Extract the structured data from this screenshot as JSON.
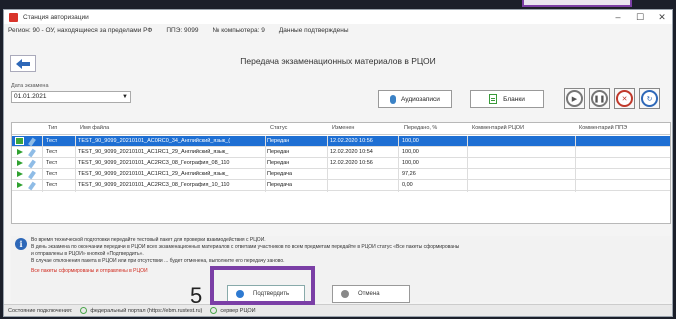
{
  "window": {
    "title": "Станция авторизации"
  },
  "info": {
    "region": "Регион: 90 - ОУ, находящиеся за пределами РФ",
    "ppe": "ППЭ: 9099",
    "computer": "№ компьютера: 9",
    "status": "Данные подтверждены"
  },
  "page": {
    "heading": "Передача экзаменационных материалов в РЦОИ"
  },
  "date": {
    "label": "Дата экзамена",
    "value": "01.01.2021"
  },
  "toolbar": {
    "audio_label": "Аудиозаписи",
    "blanks_label": "Бланки"
  },
  "table": {
    "headers": [
      "Тип",
      "Имя файла",
      "Статус",
      "Изменен",
      "Передано, %",
      "Комментарий РЦОИ",
      "Комментарий ППЭ"
    ],
    "rows": [
      {
        "type": "Тест",
        "file": "TEST_90_9099_20210101_AC0RC0_34_Английский_язык_(",
        "status": "Передан",
        "changed": "12.02.2020 10:56",
        "percent": "100,00",
        "selected": true
      },
      {
        "type": "Тест",
        "file": "TEST_90_9099_20210101_AC1RC1_29_Английский_язык_",
        "status": "Передан",
        "changed": "12.02.2020 10:54",
        "percent": "100,00",
        "selected": false
      },
      {
        "type": "Тест",
        "file": "TEST_90_9099_20210101_AC2RC3_08_География_08_110",
        "status": "Передан",
        "changed": "12.02.2020 10:56",
        "percent": "100,00",
        "selected": false
      },
      {
        "type": "Тест",
        "file": "TEST_90_9099_20210101_AC1RC1_29_Английский_язык_",
        "status": "Передача",
        "changed": "",
        "percent": "97,26",
        "selected": false
      },
      {
        "type": "Тест",
        "file": "TEST_90_9099_20210101_AC2RC3_08_География_10_110",
        "status": "Передача",
        "changed": "",
        "percent": "0,00",
        "selected": false
      }
    ]
  },
  "notice": {
    "line1": "Во время технической подготовки передайте тестовый пакет для проверки взаимодействия с РЦОИ.",
    "line2": "В день экзамена по окончании передачи в РЦОИ всех экзаменационных материалов с ответами участников по всем предметам передайте в РЦОИ статус «Все пакеты сформированы",
    "line3": "и отправлены в РЦОИ» кнопкой «Подтвердить».",
    "line4": "В случае отклонения пакета в РЦОИ или при отсутствии ... будет отменена, выполните его передачу заново.",
    "line5": "Все пакеты сформированы и отправлены в РЦОИ"
  },
  "actions": {
    "confirm_label": "Подтвердить",
    "cancel_label": "Отмена"
  },
  "annotation": {
    "step": "5"
  },
  "status": {
    "label": "Состояние подключения:",
    "portal": "федеральный портал (https://ebm.rustest.ru)",
    "server": "сервер РЦОИ"
  },
  "colors": {
    "selected_row": "#1e6fd3",
    "highlight": "#7b3fa6",
    "confirm_dot": "#2e7ad1",
    "cancel_dot": "#888888"
  }
}
